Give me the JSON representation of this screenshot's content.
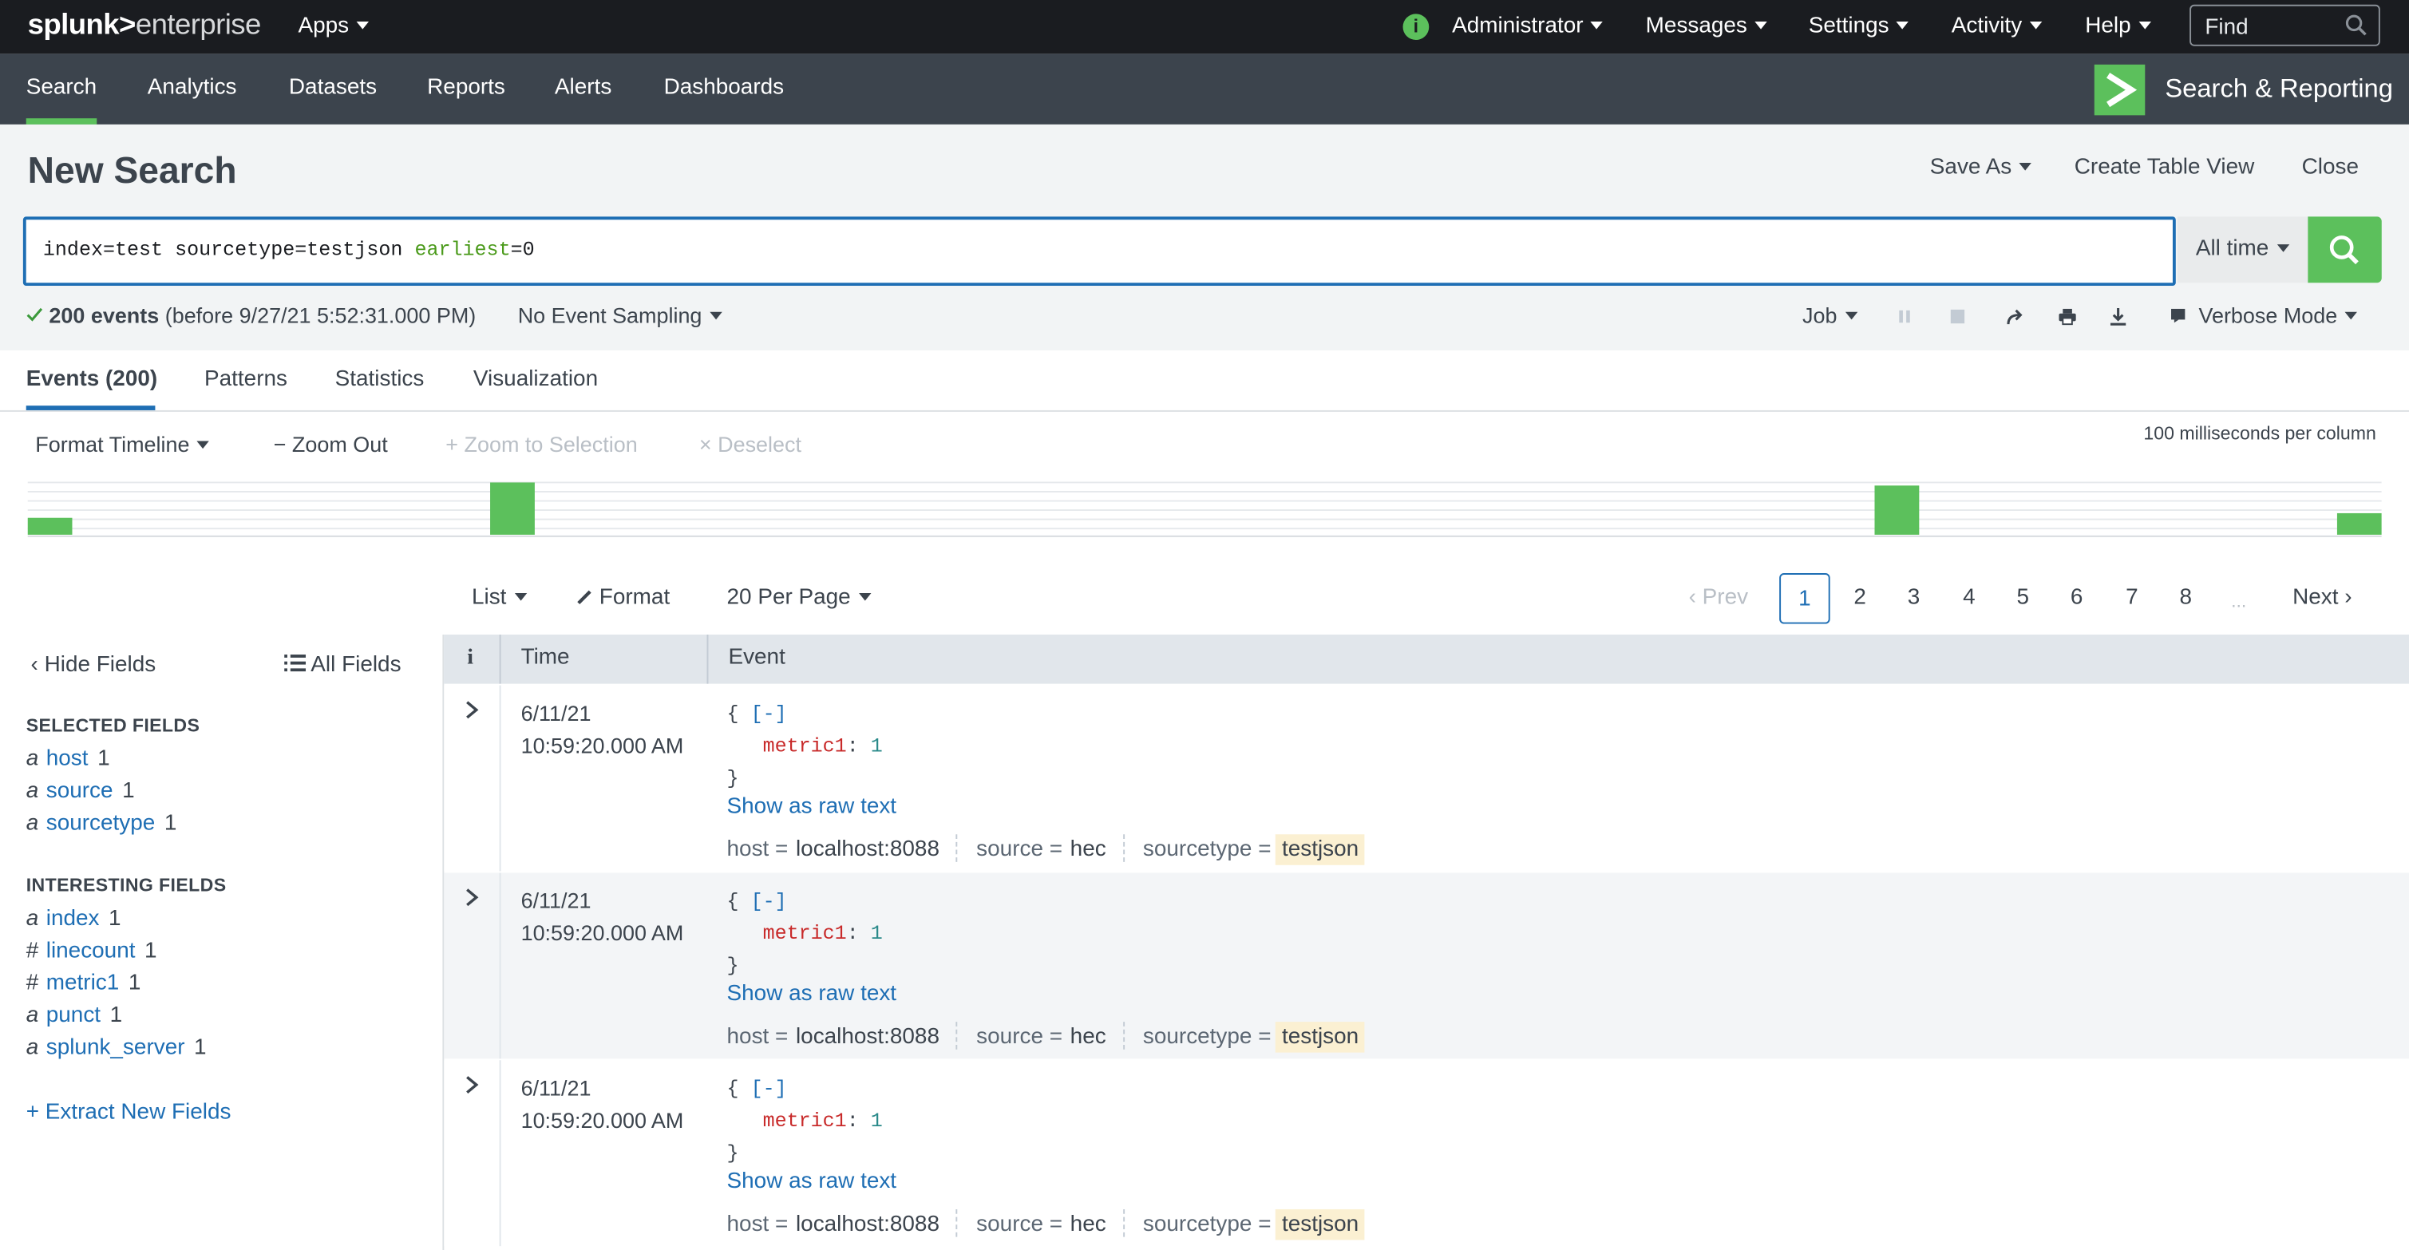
{
  "topbar": {
    "logo_bold": "splunk>",
    "logo_rest": "enterprise",
    "apps": "Apps",
    "info_glyph": "i",
    "user": "Administrator",
    "messages": "Messages",
    "settings": "Settings",
    "activity": "Activity",
    "help": "Help",
    "find_placeholder": "Find"
  },
  "appbar": {
    "tabs": [
      "Search",
      "Analytics",
      "Datasets",
      "Reports",
      "Alerts",
      "Dashboards"
    ],
    "active_tab": "Search",
    "app_name": "Search & Reporting",
    "accent_color": "#5cc05c"
  },
  "header": {
    "title": "New Search",
    "save_as": "Save As",
    "create_table_view": "Create Table View",
    "close": "Close"
  },
  "search": {
    "query_plain": "index=test sourcetype=testjson ",
    "query_keyword": "earliest",
    "query_tail": "=0",
    "time_range": "All time"
  },
  "status": {
    "count": "200 events",
    "before": "(before 9/27/21 5:52:31.000 PM)",
    "sampling": "No Event Sampling",
    "job": "Job",
    "mode": "Verbose Mode"
  },
  "tabs": [
    "Events (200)",
    "Patterns",
    "Statistics",
    "Visualization"
  ],
  "timeline": {
    "format": "Format Timeline",
    "zoom_out": "Zoom Out",
    "zoom_selection": "Zoom to Selection",
    "deselect": "Deselect",
    "scale_note": "100 milliseconds per column",
    "bar_levels": [
      0.33,
      1.0,
      0.95,
      0.4
    ]
  },
  "results_toolbar": {
    "list": "List",
    "format": "Format",
    "per_page": "20 Per Page",
    "prev": "Prev",
    "pages": [
      "1",
      "2",
      "3",
      "4",
      "5",
      "6",
      "7",
      "8"
    ],
    "current_page": "1",
    "ellipsis": "...",
    "next": "Next"
  },
  "sidebar": {
    "hide_fields": "Hide Fields",
    "all_fields": "All Fields",
    "selected_heading": "SELECTED FIELDS",
    "selected": [
      {
        "type": "a",
        "name": "host",
        "count": "1"
      },
      {
        "type": "a",
        "name": "source",
        "count": "1"
      },
      {
        "type": "a",
        "name": "sourcetype",
        "count": "1"
      }
    ],
    "interesting_heading": "INTERESTING FIELDS",
    "interesting": [
      {
        "type": "a",
        "name": "index",
        "count": "1"
      },
      {
        "type": "#",
        "name": "linecount",
        "count": "1"
      },
      {
        "type": "#",
        "name": "metric1",
        "count": "1"
      },
      {
        "type": "a",
        "name": "punct",
        "count": "1"
      },
      {
        "type": "a",
        "name": "splunk_server",
        "count": "1"
      }
    ],
    "extract": "Extract New Fields"
  },
  "table": {
    "info_col": "i",
    "time_col": "Time",
    "event_col": "Event",
    "rows": [
      {
        "date": "6/11/21",
        "time": "10:59:20.000 AM",
        "open": "{",
        "toggle": "[-]",
        "key": "metric1",
        "value": "1",
        "close": "}",
        "raw": "Show as raw text",
        "host_k": "host =",
        "host_v": "localhost:8088",
        "source_k": "source =",
        "source_v": "hec",
        "st_k": "sourcetype =",
        "st_v": "testjson"
      },
      {
        "date": "6/11/21",
        "time": "10:59:20.000 AM",
        "open": "{",
        "toggle": "[-]",
        "key": "metric1",
        "value": "1",
        "close": "}",
        "raw": "Show as raw text",
        "host_k": "host =",
        "host_v": "localhost:8088",
        "source_k": "source =",
        "source_v": "hec",
        "st_k": "sourcetype =",
        "st_v": "testjson"
      },
      {
        "date": "6/11/21",
        "time": "10:59:20.000 AM",
        "open": "{",
        "toggle": "[-]",
        "key": "metric1",
        "value": "1",
        "close": "}",
        "raw": "Show as raw text",
        "host_k": "host =",
        "host_v": "localhost:8088",
        "source_k": "source =",
        "source_v": "hec",
        "st_k": "sourcetype =",
        "st_v": "testjson"
      }
    ]
  }
}
